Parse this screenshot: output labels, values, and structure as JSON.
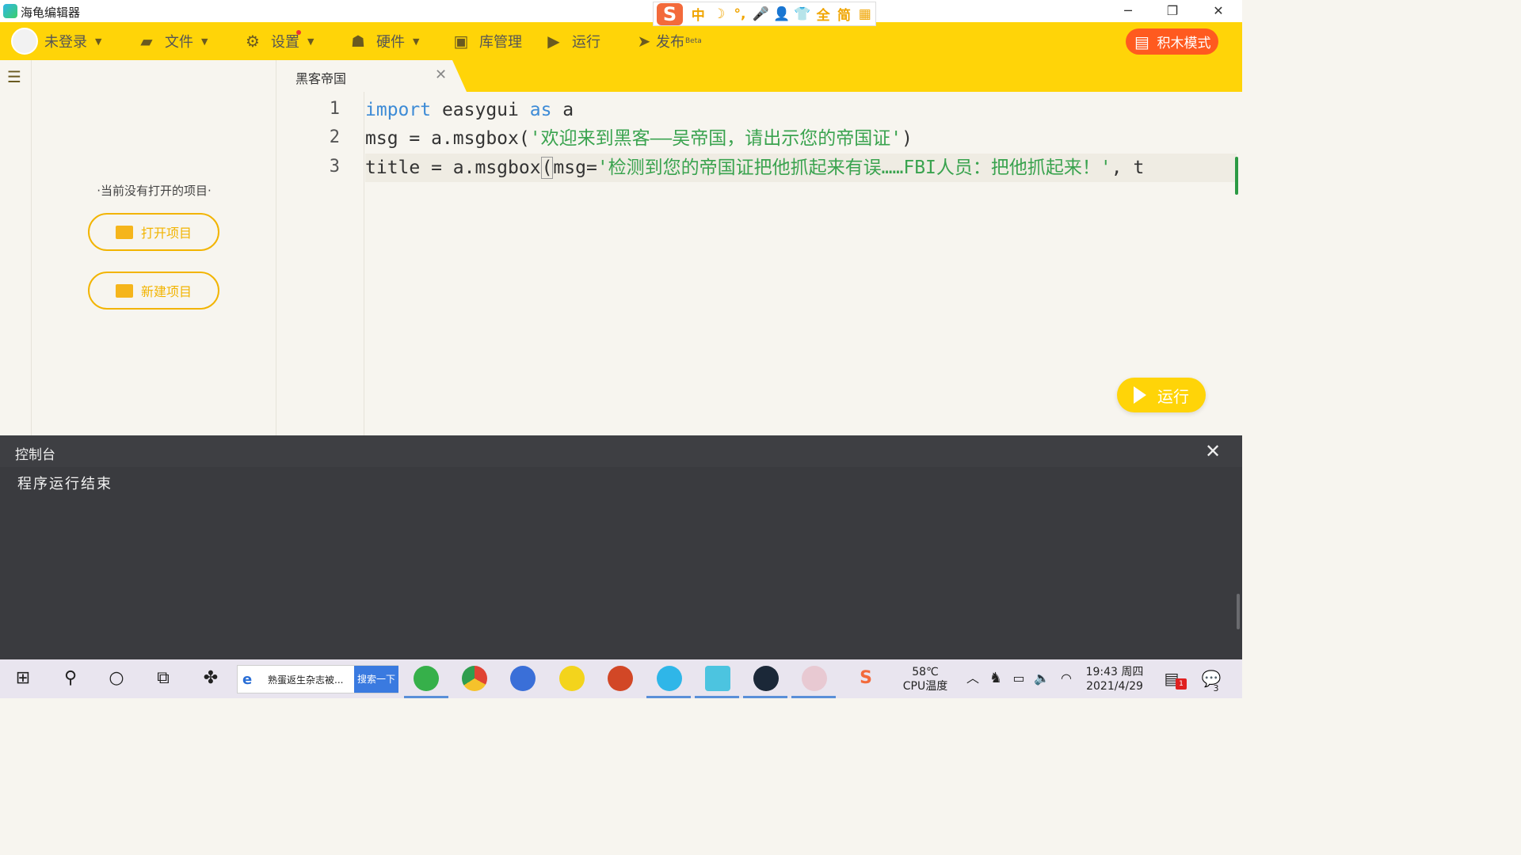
{
  "app": {
    "title": "海龟编辑器",
    "minimize_glyph": "─",
    "restore_glyph": "❐",
    "close_glyph": "✕"
  },
  "ime": {
    "logo": "S",
    "items": [
      "中",
      "☽",
      "°,",
      "🎤",
      "👤",
      "👕",
      "全",
      "简",
      "▦"
    ]
  },
  "menu": {
    "user": "未登录",
    "file": "文件",
    "settings": "设置",
    "hardware": "硬件",
    "library": "库管理",
    "run": "运行",
    "publish": "发布",
    "publish_badge": "Beta",
    "block_mode": "积木模式"
  },
  "sidebar": {
    "empty_text": "·当前没有打开的项目·",
    "open_project": "打开项目",
    "new_project": "新建项目"
  },
  "editor": {
    "tab_title": "黑客帝国",
    "line_numbers": [
      "1",
      "2",
      "3"
    ],
    "line1": {
      "kw1": "import",
      "t1": " easygui ",
      "kw2": "as",
      "t2": " a"
    },
    "line2": {
      "t1": "msg = a.msgbox(",
      "s1": "'欢迎来到黑客——吴帝国，请出示您的帝国证'",
      "t2": ")"
    },
    "line3": {
      "t1": "title = a.msgbox",
      "p": "(",
      "t2": "msg=",
      "s1": "'检测到您的帝国证把他抓起来有误……FBI人员：把他抓起来！'",
      "t3": ", t"
    },
    "run_button": "运行"
  },
  "console": {
    "title": "控制台",
    "output": "程序运行结束",
    "close_glyph": "✕"
  },
  "taskbar": {
    "search_text": "熟蛋返生杂志被...",
    "search_button": "搜索一下",
    "temp": "58℃",
    "temp_label": "CPU温度",
    "time": "19:43 周四",
    "date": "2021/4/29",
    "notif_count": "1",
    "action_count": "3",
    "colors": {
      "accent": "#ffd408",
      "orange": "#ff5a1f"
    }
  }
}
